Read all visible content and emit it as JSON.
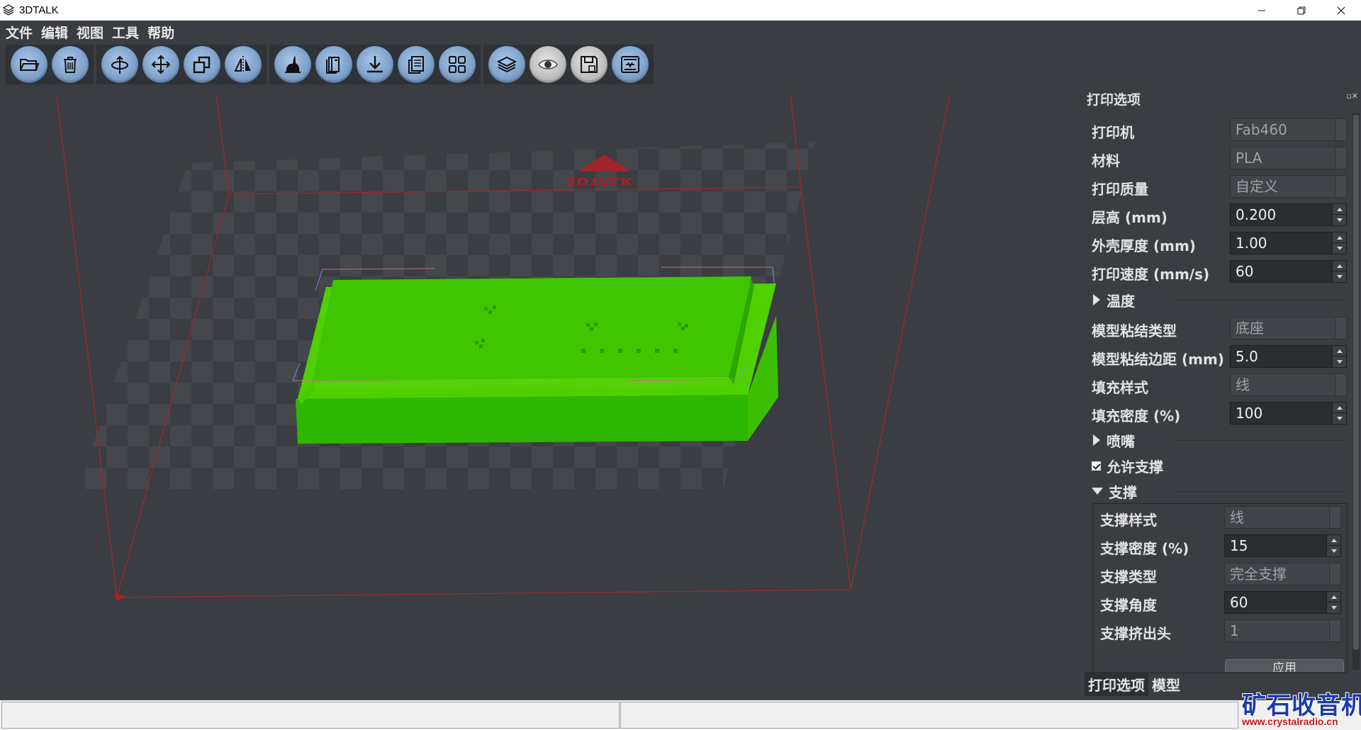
{
  "window": {
    "title": "3DTALK"
  },
  "menu": [
    "文件",
    "编辑",
    "视图",
    "工具",
    "帮助"
  ],
  "toolbar": {
    "groups": [
      [
        "folder-open-icon",
        "trash-icon"
      ],
      [
        "rotate-icon",
        "move-icon",
        "scale-icon",
        "mirror-icon"
      ],
      [
        "model-library-icon",
        "books-icon",
        "download-icon",
        "copy-icon",
        "grid-layout-icon"
      ],
      [
        "layers-icon",
        "eye-icon",
        "save-icon",
        "print-icon"
      ]
    ]
  },
  "viewport": {
    "front_label": "3DTALK"
  },
  "panel": {
    "title": "打印选项",
    "printer": {
      "label": "打印机",
      "value": "Fab460"
    },
    "material": {
      "label": "材料",
      "value": "PLA"
    },
    "quality": {
      "label": "打印质量",
      "value": "自定义"
    },
    "layer_height": {
      "label": "层高 (mm)",
      "value": "0.200"
    },
    "shell": {
      "label": "外壳厚度 (mm)",
      "value": "1.00"
    },
    "speed": {
      "label": "打印速度 (mm/s)",
      "value": "60"
    },
    "temperature": {
      "label": "温度"
    },
    "adhesion_type": {
      "label": "模型粘结类型",
      "value": "底座"
    },
    "adhesion_margin": {
      "label": "模型粘结边距 (mm)",
      "value": "5.0"
    },
    "infill_pattern": {
      "label": "填充样式",
      "value": "线"
    },
    "infill_density": {
      "label": "填充密度 (%)",
      "value": "100"
    },
    "nozzle": {
      "label": "喷嘴"
    },
    "allow_support": {
      "label": "允许支撑",
      "checked": true
    },
    "support": {
      "label": "支撑",
      "pattern": {
        "label": "支撑样式",
        "value": "线"
      },
      "density": {
        "label": "支撑密度 (%)",
        "value": "15"
      },
      "type": {
        "label": "支撑类型",
        "value": "完全支撑"
      },
      "angle": {
        "label": "支撑角度",
        "value": "60"
      },
      "extruder": {
        "label": "支撑挤出头",
        "value": "1"
      }
    },
    "apply_button": "应用"
  },
  "tabs": [
    "打印选项",
    "模型"
  ],
  "watermark": {
    "title": "矿石收音机",
    "url": "www.crystalradio.cn"
  },
  "colors": {
    "model": "#38c200",
    "grid_border": "#a3232a",
    "background": "#3a3d41"
  }
}
